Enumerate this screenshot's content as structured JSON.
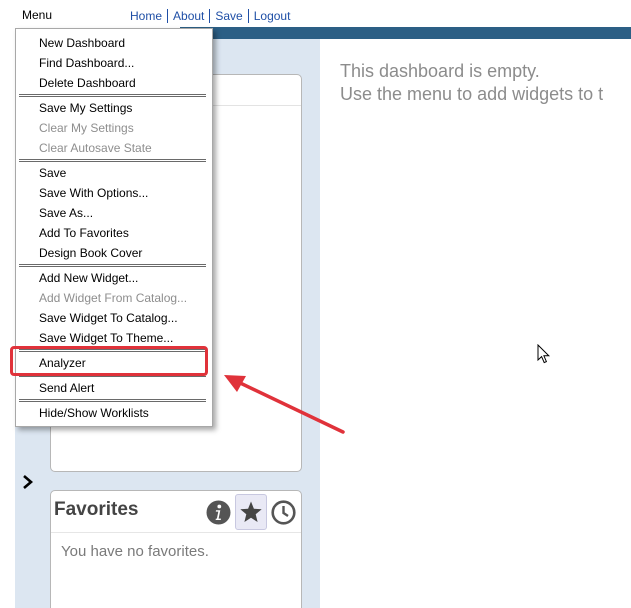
{
  "topbar": {
    "menu_label": "Menu",
    "nav": [
      "Home",
      "About",
      "Save",
      "Logout"
    ]
  },
  "menu": {
    "groups": [
      [
        {
          "label": "New Dashboard",
          "enabled": true
        },
        {
          "label": "Find Dashboard...",
          "enabled": true
        },
        {
          "label": "Delete Dashboard",
          "enabled": true
        }
      ],
      [
        {
          "label": "Save My Settings",
          "enabled": true
        },
        {
          "label": "Clear My Settings",
          "enabled": false
        },
        {
          "label": "Clear Autosave State",
          "enabled": false
        }
      ],
      [
        {
          "label": "Save",
          "enabled": true
        },
        {
          "label": "Save With Options...",
          "enabled": true
        },
        {
          "label": "Save As...",
          "enabled": true
        },
        {
          "label": "Add To Favorites",
          "enabled": true
        },
        {
          "label": "Design Book Cover",
          "enabled": true
        }
      ],
      [
        {
          "label": "Add New Widget...",
          "enabled": true
        },
        {
          "label": "Add Widget From Catalog...",
          "enabled": false
        },
        {
          "label": "Save Widget To Catalog...",
          "enabled": true
        },
        {
          "label": "Save Widget To Theme...",
          "enabled": true
        }
      ],
      [
        {
          "label": "Analyzer",
          "enabled": true
        }
      ],
      [
        {
          "label": "Send Alert",
          "enabled": true
        }
      ],
      [
        {
          "label": "Hide/Show Worklists",
          "enabled": true
        }
      ]
    ],
    "highlighted_item": "Analyzer"
  },
  "main": {
    "empty_line1": "This dashboard is empty.",
    "empty_line2": "Use the menu to add widgets to t"
  },
  "favorites": {
    "title": "Favorites",
    "empty_text": "You have no favorites.",
    "icons": [
      "info-icon",
      "star-icon",
      "clock-icon"
    ]
  },
  "colors": {
    "header_strip": "#2c5f85",
    "left_panel": "#dce6f1",
    "link": "#1f4fa6",
    "annotation": "#e0323a"
  }
}
